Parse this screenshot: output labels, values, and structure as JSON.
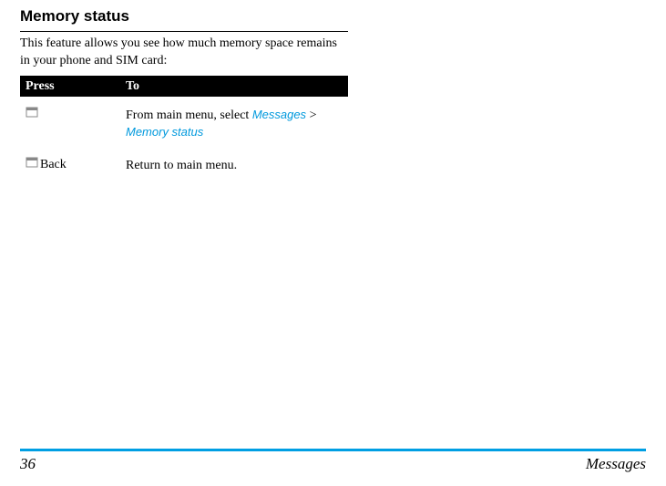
{
  "heading": "Memory status",
  "intro": "This feature allows you see how much memory space remains in your phone and SIM card:",
  "table": {
    "header": {
      "press": "Press",
      "to": "To"
    },
    "rows": [
      {
        "press_label": "",
        "to_prefix": "From main menu, select ",
        "link1": "Messages",
        "separator": " > ",
        "link2": "Memory status"
      },
      {
        "press_label": "Back",
        "to_text": "Return to main menu."
      }
    ]
  },
  "footer": {
    "page": "36",
    "section": "Messages"
  }
}
